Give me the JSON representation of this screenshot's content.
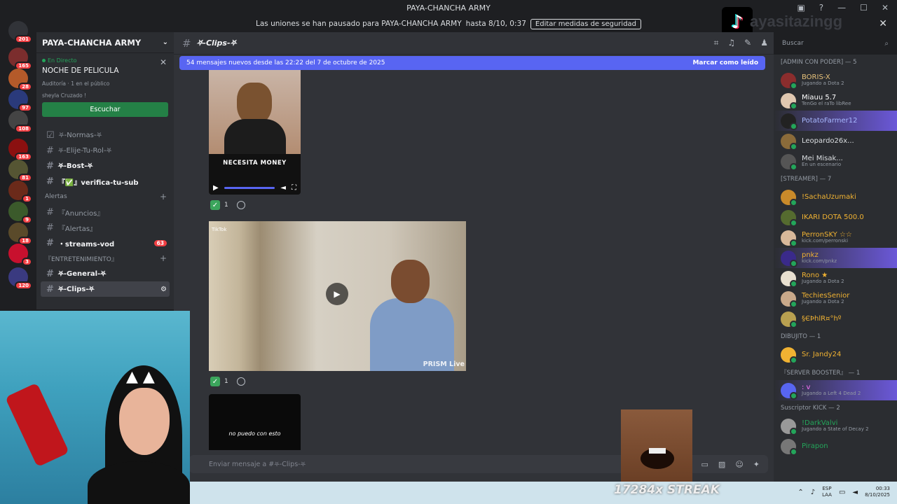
{
  "window": {
    "title": "PAYA-CHANCHA ARMY"
  },
  "notice": {
    "text": "Las uniones se han pausado para PAYA-CHANCHA ARMY",
    "until": "hasta 8/10, 0:37",
    "button": "Editar medidas de seguridad"
  },
  "overlay": {
    "handle": "ayasitazingg"
  },
  "rail": {
    "badges": [
      "201",
      "165",
      "28",
      "97",
      "108",
      "163",
      "81",
      "1",
      "9",
      "18",
      "3",
      "120"
    ]
  },
  "guild": {
    "name": "PAYA-CHANCHA ARMY"
  },
  "live": {
    "tag": "En Directo",
    "title": "NOCHE DE PELICULA",
    "auditorium": "Auditoría",
    "audience": "1 en el público",
    "member": "sheyla Cruzado !",
    "listen": "Escuchar"
  },
  "channels": [
    {
      "name": "⛧-Normas-⛧",
      "bold": false
    },
    {
      "name": "⛧-Elije-Tu-Rol-⛧",
      "bold": false
    },
    {
      "name": "⛧-Bost-⛧",
      "bold": true
    },
    {
      "name": "『✅』verifica-tu-sub",
      "bold": true
    }
  ],
  "cat_alertas": "Alertas",
  "channels2": [
    {
      "name": "『Anuncios』",
      "bold": false
    },
    {
      "name": "『Alertas』",
      "bold": false
    },
    {
      "name": "・streams-vod",
      "bold": true,
      "count": "63"
    }
  ],
  "cat_ent": "『ENTRETENIMIENTO』",
  "channels3": [
    {
      "name": "⛧-General-⛧",
      "bold": true
    },
    {
      "name": "⛧-Clips-⛧",
      "bold": true,
      "selected": true
    }
  ],
  "chat": {
    "channel": "⛧-Clips-⛧",
    "new_msgs": "54 mensajes nuevos desde las 22:22 del 7 de octubre de 2025",
    "mark_read": "Marcar como leído",
    "search": "Buscar"
  },
  "clips": {
    "cap1": "NECESITA MONEY",
    "react_count1": "1",
    "react_count2": "1",
    "tiktok": "TikTok",
    "prism": "PRISM Live",
    "cap3": "no puedo con esto"
  },
  "composer": {
    "placeholder": "Enviar mensaje a #⛧-Clips-⛧"
  },
  "members": {
    "groups": [
      {
        "label": "[ADMIN CON PODER] — 5",
        "items": [
          {
            "name": "BORIS-X",
            "status": "Jugando a Dota 2",
            "color": "#e6c17a"
          },
          {
            "name": "Miauu 5.7",
            "status": "TenGo el raTo libRee",
            "color": "#ffffff"
          },
          {
            "name": "PotatoFarmer12",
            "status": "",
            "color": "#a8b8ff",
            "hl": true
          },
          {
            "name": "Leopardo26x...",
            "status": "",
            "color": "#dbdee1"
          },
          {
            "name": "Mei Misak...",
            "status": "En un escenario",
            "color": "#dbdee1"
          }
        ]
      },
      {
        "label": "[STREAMER] — 7",
        "items": [
          {
            "name": "!SachaUzumaki",
            "status": "",
            "color": "#f0b232"
          },
          {
            "name": "IKARI DOTA 500.0",
            "status": "",
            "color": "#f0b232"
          },
          {
            "name": "PerronSKY ☆☆",
            "status": "kick.com/perronski",
            "color": "#f0b232"
          },
          {
            "name": "pnkz",
            "status": "kick.com/pnkz",
            "color": "#f0b232",
            "hl": true
          },
          {
            "name": "Rono ★",
            "status": "Jugando a Dota 2",
            "color": "#f0b232"
          },
          {
            "name": "TechiesSenior",
            "status": "Jugando a Dota 2",
            "color": "#f0b232"
          },
          {
            "name": "§ЄÞhlR¤°hº",
            "status": "",
            "color": "#f0b232"
          }
        ]
      },
      {
        "label": "DIBUJITO — 1",
        "items": [
          {
            "name": "Sr. Jandy24",
            "status": "",
            "color": "#f0b232"
          }
        ]
      },
      {
        "label": "『SERVER BOOSTER』 — 1",
        "items": [
          {
            "name": ": v",
            "status": "Jugando a Left 4 Dead 2",
            "color": "#ff73fa",
            "hl": true
          }
        ]
      },
      {
        "label": "Suscriptor KICK — 2",
        "items": [
          {
            "name": "!DarkValvi",
            "status": "Jugando a State of Decay 2",
            "color": "#23a55a"
          },
          {
            "name": "Pirapon",
            "status": "",
            "color": "#23a55a"
          }
        ]
      }
    ]
  },
  "stream": {
    "streak": "17284x STREAK"
  },
  "taskbar": {
    "lang1": "ESP",
    "lang2": "LAA",
    "time": "00:33",
    "date": "8/10/2025"
  }
}
